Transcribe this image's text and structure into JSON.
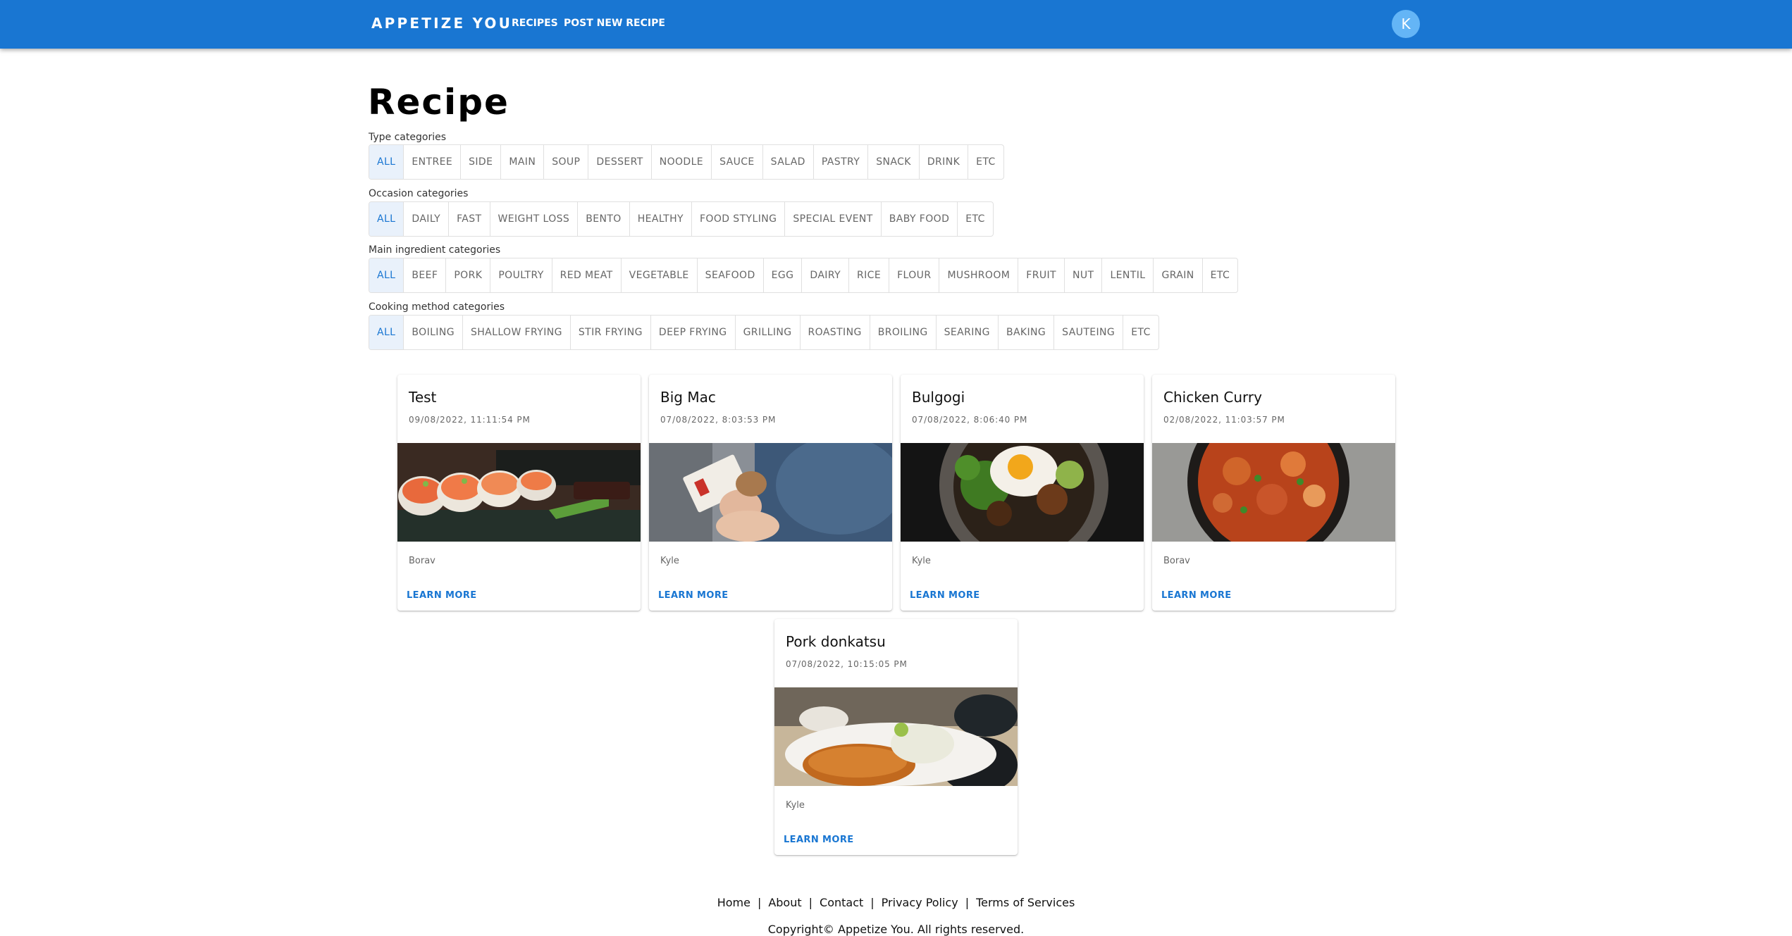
{
  "header": {
    "brand": "APPETIZE YOU",
    "nav": [
      "RECIPES",
      "POST NEW RECIPE"
    ],
    "avatar_initial": "K",
    "color": "#1976d2"
  },
  "page": {
    "title": "Recipe"
  },
  "categories": [
    {
      "label": "Type categories",
      "selected": "ALL",
      "options": [
        "ALL",
        "ENTREE",
        "SIDE",
        "MAIN",
        "SOUP",
        "DESSERT",
        "NOODLE",
        "SAUCE",
        "SALAD",
        "PASTRY",
        "SNACK",
        "DRINK",
        "ETC"
      ]
    },
    {
      "label": "Occasion categories",
      "selected": "ALL",
      "options": [
        "ALL",
        "DAILY",
        "FAST",
        "WEIGHT LOSS",
        "BENTO",
        "HEALTHY",
        "FOOD STYLING",
        "SPECIAL EVENT",
        "BABY FOOD",
        "ETC"
      ]
    },
    {
      "label": "Main ingredient categories",
      "selected": "ALL",
      "options": [
        "ALL",
        "BEEF",
        "PORK",
        "POULTRY",
        "RED MEAT",
        "VEGETABLE",
        "SEAFOOD",
        "EGG",
        "DAIRY",
        "RICE",
        "FLOUR",
        "MUSHROOM",
        "FRUIT",
        "NUT",
        "LENTIL",
        "GRAIN",
        "ETC"
      ]
    },
    {
      "label": "Cooking method categories",
      "selected": "ALL",
      "options": [
        "ALL",
        "BOILING",
        "SHALLOW FRYING",
        "STIR FRYING",
        "DEEP FRYING",
        "GRILLING",
        "ROASTING",
        "BROILING",
        "SEARING",
        "BAKING",
        "SAUTEING",
        "ETC"
      ]
    }
  ],
  "recipes": [
    {
      "title": "Test",
      "date": "09/08/2022, 11:11:54 PM",
      "author": "Borav",
      "action": "LEARN MORE",
      "image": "sushi-photo"
    },
    {
      "title": "Big Mac",
      "date": "07/08/2022, 8:03:53 PM",
      "author": "Kyle",
      "action": "LEARN MORE",
      "image": "burger-photo"
    },
    {
      "title": "Bulgogi",
      "date": "07/08/2022, 8:06:40 PM",
      "author": "Kyle",
      "action": "LEARN MORE",
      "image": "bulgogi-photo"
    },
    {
      "title": "Chicken Curry",
      "date": "02/08/2022, 11:03:57 PM",
      "author": "Borav",
      "action": "LEARN MORE",
      "image": "curry-photo"
    },
    {
      "title": "Pork donkatsu",
      "date": "07/08/2022, 10:15:05 PM",
      "author": "Kyle",
      "action": "LEARN MORE",
      "image": "donkatsu-photo"
    }
  ],
  "footer": {
    "links": [
      "Home",
      "About",
      "Contact",
      "Privacy Policy",
      "Terms of Services"
    ],
    "copyright": "Copyright© Appetize You. All rights reserved."
  }
}
